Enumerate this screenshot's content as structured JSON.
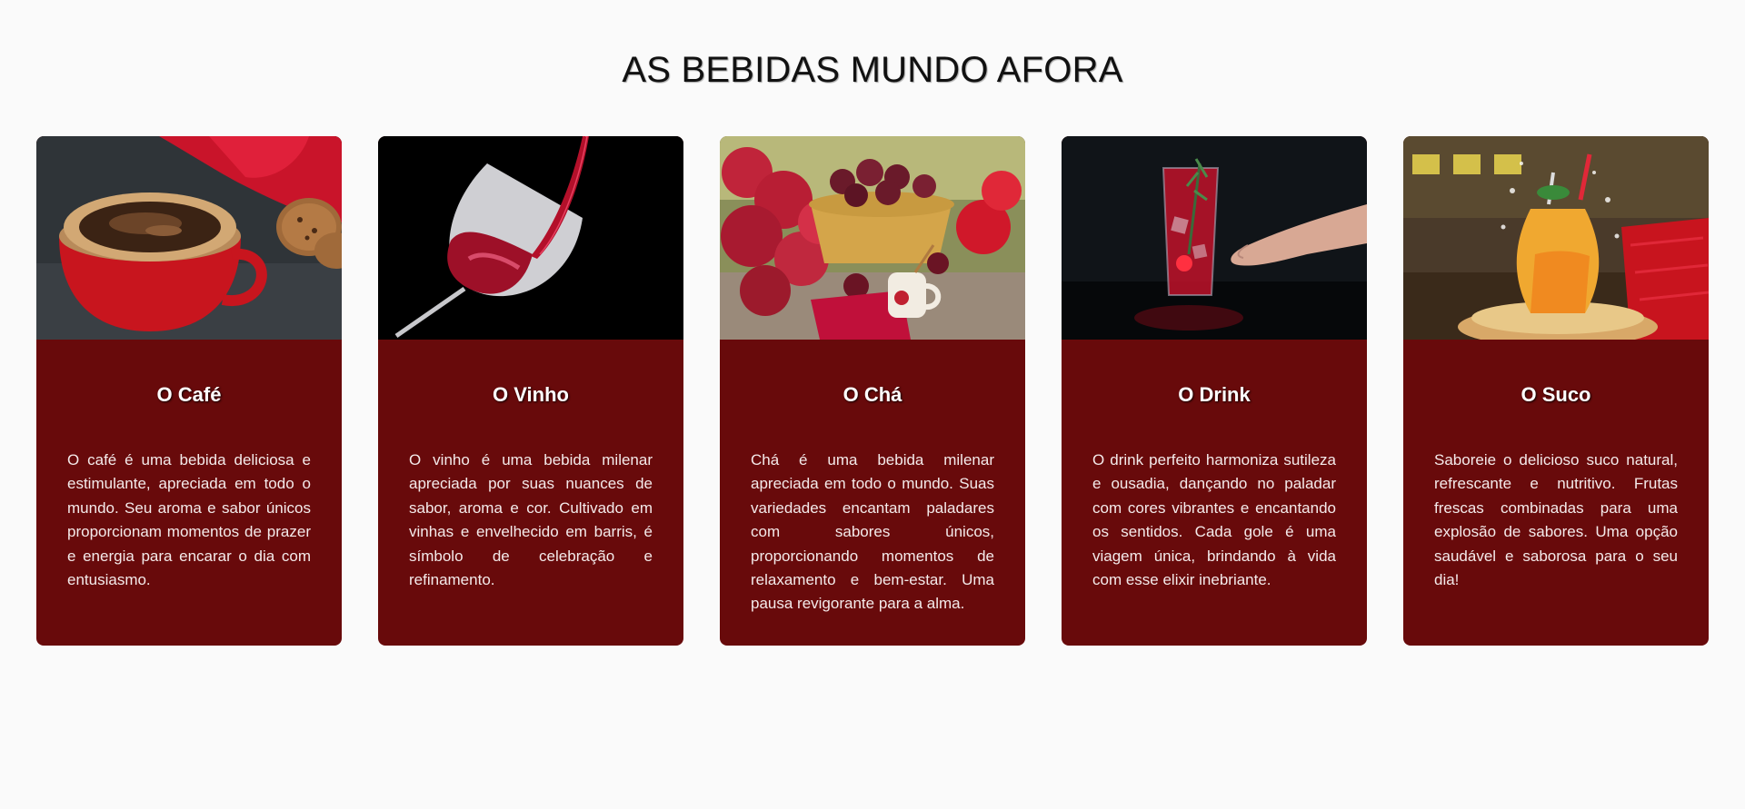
{
  "page": {
    "title": "AS BEBIDAS MUNDO AFORA"
  },
  "colors": {
    "background": "#fafafa",
    "card_background": "#680a0b",
    "card_text": "#f4eaea",
    "title_text": "#111111"
  },
  "cards": [
    {
      "image_icon": "coffee-cup-image",
      "title": "O Café",
      "text": "O café é uma bebida deliciosa e estimulante, apreciada em todo o mundo. Seu aroma e sabor únicos proporcionam momentos de prazer e energia para encarar o dia com entusiasmo."
    },
    {
      "image_icon": "wine-glass-image",
      "title": "O Vinho",
      "text": "O vinho é uma bebida milenar apreciada por suas nuances de sabor, aroma e cor. Cultivado em vinhas e envelhecido em barris, é símbolo de celebração e refinamento."
    },
    {
      "image_icon": "tea-flowers-image",
      "title": "O Chá",
      "text": "Chá é uma bebida milenar apreciada em todo o mundo. Suas variedades encantam paladares com sabores únicos, proporcionando momentos de relaxamento e bem-estar. Uma pausa revigorante para a alma."
    },
    {
      "image_icon": "red-drink-image",
      "title": "O Drink",
      "text": "O drink perfeito harmoniza sutileza e ousadia, dançando no paladar com cores vibrantes e encantando os sentidos. Cada gole é uma viagem única, brindando à vida com esse elixir inebriante."
    },
    {
      "image_icon": "juice-splash-image",
      "title": "O Suco",
      "text": "Saboreie o delicioso suco natural, refrescante e nutritivo. Frutas frescas combinadas para uma explosão de sabores. Uma opção saudável e saborosa para o seu dia!"
    }
  ]
}
